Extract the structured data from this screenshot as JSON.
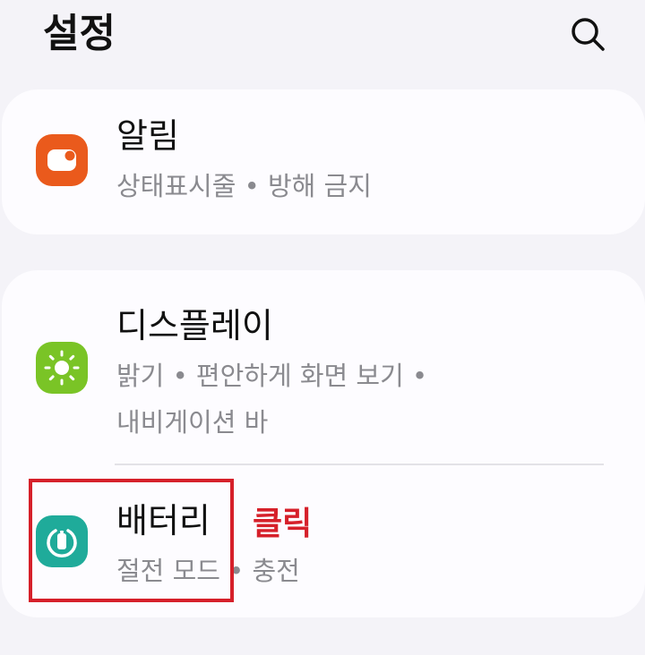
{
  "header": {
    "title": "설정",
    "search_icon": "search-icon"
  },
  "items": [
    {
      "id": "notifications",
      "title": "알림",
      "subtitle": "상태표시줄 • 방해 금지",
      "icon": "notification-bell-icon",
      "icon_color": "#ea5a1c"
    },
    {
      "id": "display",
      "title": "디스플레이",
      "subtitle_line1": "밝기 • 편안하게 화면 보기 •",
      "subtitle_line2": "내비게이션 바",
      "icon": "sun-brightness-icon",
      "icon_color": "#7ac426"
    },
    {
      "id": "battery",
      "title": "배터리",
      "subtitle": "절전 모드 • 충전",
      "icon": "battery-icon",
      "icon_color": "#1fab9a"
    }
  ],
  "annotation": {
    "label": "클릭",
    "color": "#d6202a"
  }
}
